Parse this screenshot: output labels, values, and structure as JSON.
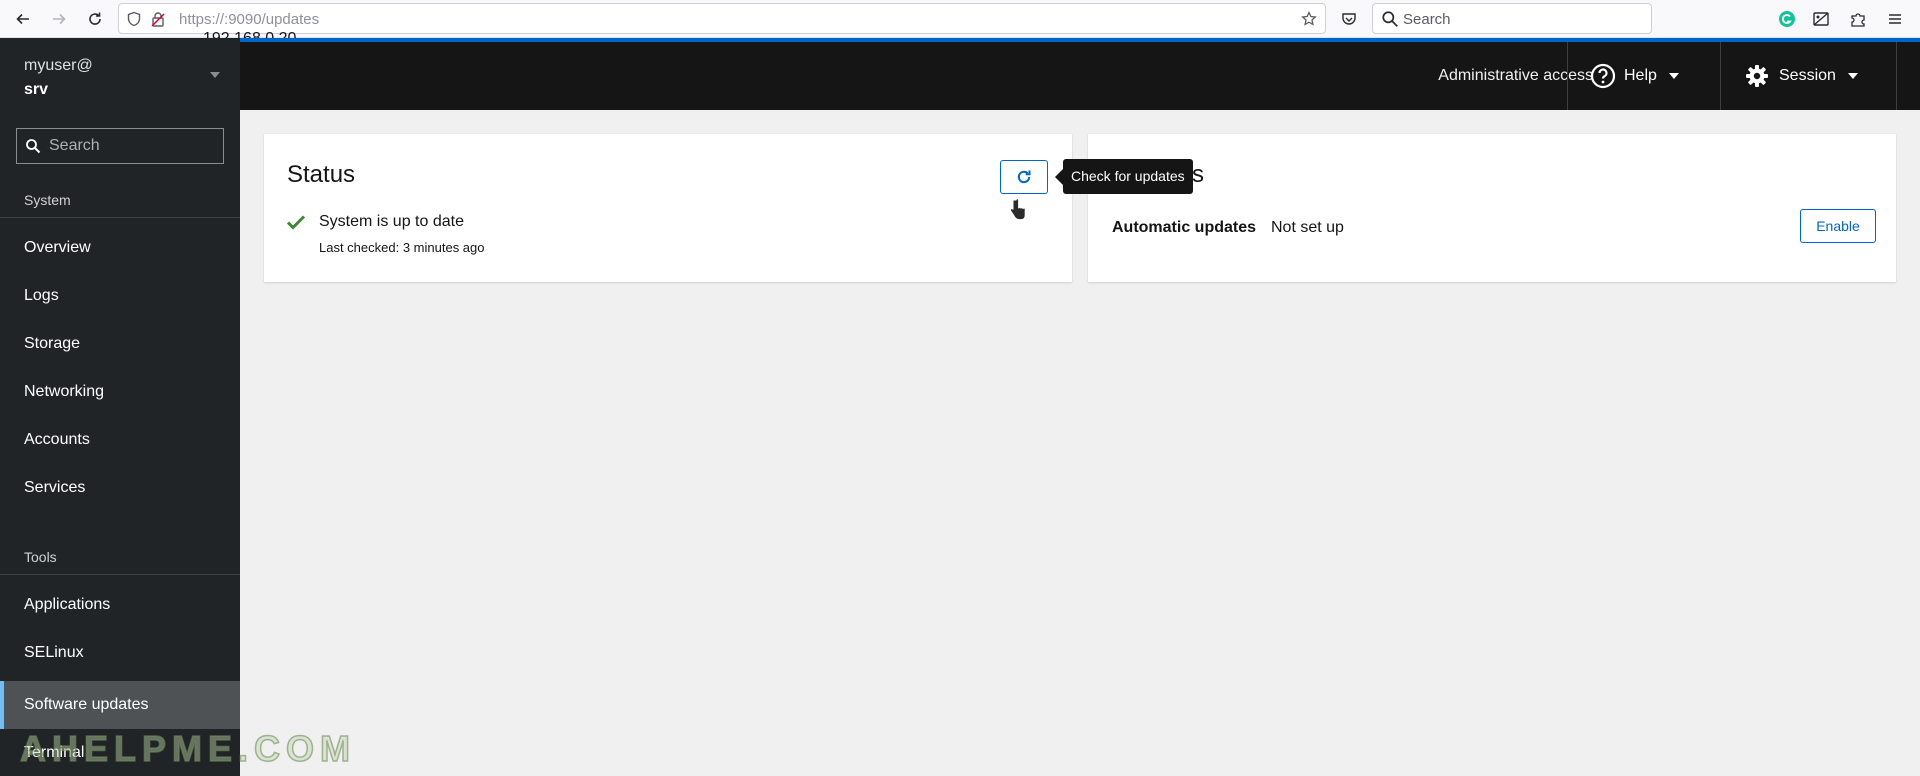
{
  "browser": {
    "url_prefix": "https://",
    "url_host": "192.168.0.20",
    "url_path": ":9090/updates",
    "search_placeholder": "Search"
  },
  "sidebar": {
    "host_user": "myuser@",
    "host_name": "srv",
    "search_placeholder": "Search",
    "sections": [
      {
        "title": "System",
        "items": [
          {
            "label": "Overview"
          },
          {
            "label": "Logs"
          },
          {
            "label": "Storage"
          },
          {
            "label": "Networking"
          },
          {
            "label": "Accounts"
          },
          {
            "label": "Services"
          }
        ]
      },
      {
        "title": "Tools",
        "items": [
          {
            "label": "Applications"
          },
          {
            "label": "SELinux"
          },
          {
            "label": "Software updates",
            "active": true
          },
          {
            "label": "Terminal"
          }
        ]
      }
    ]
  },
  "masthead": {
    "admin_access": "Administrative access",
    "help_label": "Help",
    "session_label": "Session"
  },
  "status_card": {
    "title": "Status",
    "message": "System is up to date",
    "last_checked": "Last checked: 3 minutes ago",
    "refresh_tooltip": "Check for updates"
  },
  "settings_card": {
    "title_visible": "s",
    "auto_updates_label": "Automatic updates",
    "auto_updates_value": "Not set up",
    "enable_label": "Enable"
  },
  "watermark": "AHELPME.COM",
  "colors": {
    "accent": "#0066cc",
    "success": "#3e8635",
    "sidebar_bg": "#212427",
    "masthead_bg": "#151515"
  }
}
